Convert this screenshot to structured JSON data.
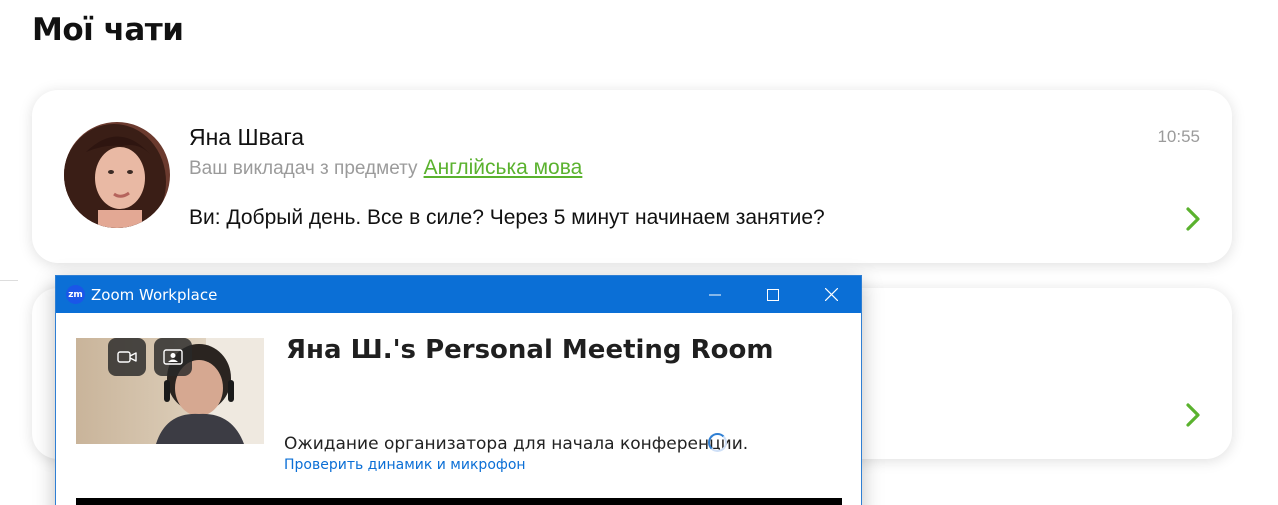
{
  "page": {
    "title": "Мої чати"
  },
  "chats": [
    {
      "name": "Яна Швага",
      "subtitle_prefix": "Ваш викладач з предмету",
      "subject": "Англійська мова",
      "message": "Ви: Добрый день. Все в силе? Через 5 минут начинаем занятие?",
      "time": "10:55"
    }
  ],
  "zoom": {
    "window_title": "Zoom Workplace",
    "logo_text": "zm",
    "room_title": "Яна Ш.'s Personal Meeting Room",
    "waiting_text": "Ожидание организатора для начала конференции.",
    "check_link": "Проверить динамик и микрофон"
  },
  "colors": {
    "accent_green": "#5ab22e",
    "zoom_blue": "#0b6fd6",
    "muted_text": "#9b9b9b"
  },
  "icons": {
    "chevron": "chevron-right-icon",
    "video": "video-camera-icon",
    "avatar": "user-portrait-icon"
  }
}
